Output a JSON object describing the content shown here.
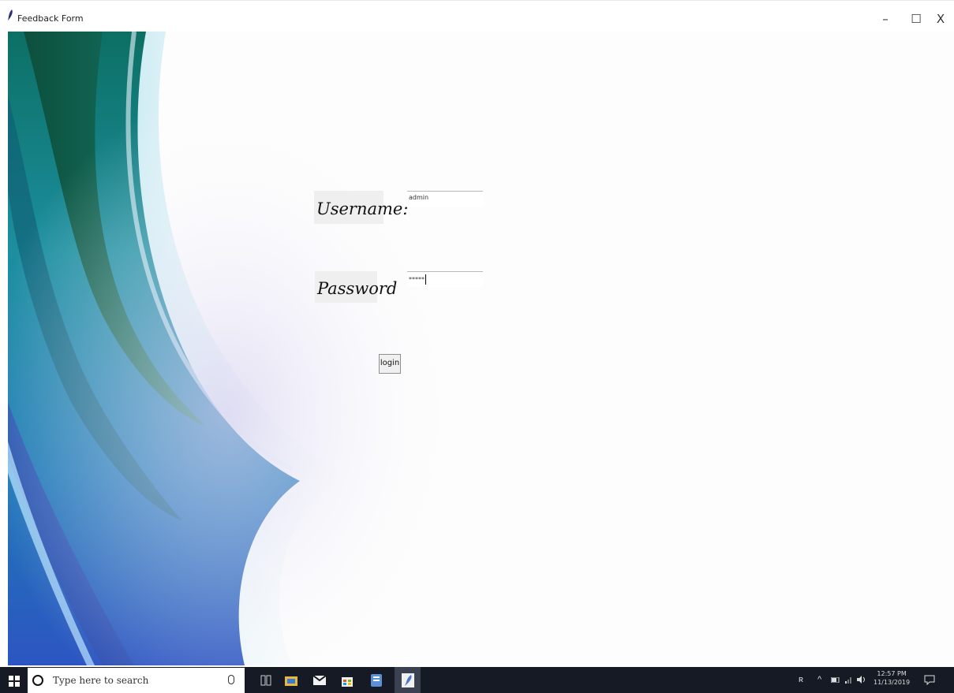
{
  "window": {
    "title": "Feedback Form",
    "controls": {
      "minimize": "–",
      "maximize": "☐",
      "close": "X"
    }
  },
  "form": {
    "username_label": "Username:",
    "username_value": "admin",
    "password_label": "Password",
    "password_value": "*****",
    "login_label": "login"
  },
  "taskbar": {
    "search_placeholder": "Type here to search",
    "icons": [
      "windows-start-icon",
      "cortana-icon",
      "microphone-icon",
      "task-view-icon",
      "file-explorer-icon",
      "mail-icon",
      "store-icon",
      "app-icon",
      "python-feather-icon"
    ],
    "tray_icons": [
      "people-icon",
      "chevron-up-icon",
      "battery-icon",
      "network-icon",
      "volume-icon"
    ],
    "time": "12:57 PM",
    "date": "11/13/2019"
  },
  "colors": {
    "taskbar_bg": "#151a24",
    "art_teal": "#1f8b8c",
    "art_blue": "#2b5fbf"
  }
}
